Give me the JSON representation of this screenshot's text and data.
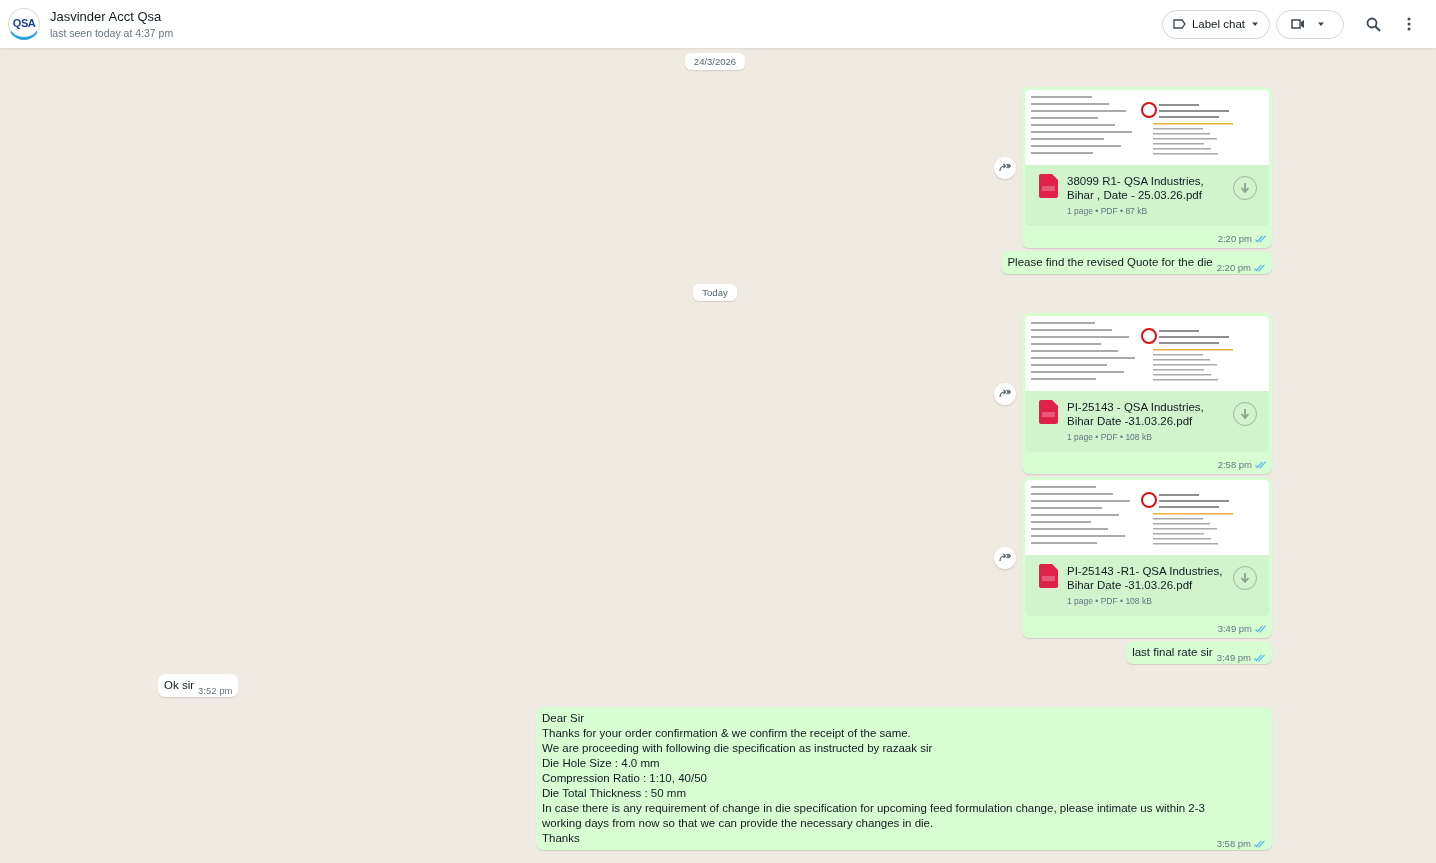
{
  "header": {
    "avatar_text": "QSA",
    "name": "Jasvinder Acct Qsa",
    "status": "last seen today at 4:37 pm",
    "label_button": "Label chat"
  },
  "messages": [
    {
      "kind": "date",
      "text": "24/3/2026"
    },
    {
      "kind": "document",
      "outgoing": true,
      "file_name": "38099 R1- QSA Industries, Bihar , Date - 25.03.26.pdf",
      "meta": "1 page • PDF • 87 kB",
      "time": "2:20 pm",
      "read": true
    },
    {
      "kind": "text",
      "outgoing": true,
      "text": "Please find the revised Quote for the die",
      "time": "2:20 pm",
      "read": true
    },
    {
      "kind": "date",
      "text": "Today"
    },
    {
      "kind": "document",
      "outgoing": true,
      "file_name": "PI-25143 - QSA Industries, Bihar Date -31.03.26.pdf",
      "meta": "1 page • PDF • 108 kB",
      "time": "2:58 pm",
      "read": true
    },
    {
      "kind": "document",
      "outgoing": true,
      "file_name": "PI-25143 -R1- QSA Industries, Bihar Date -31.03.26.pdf",
      "meta": "1 page • PDF • 108 kB",
      "time": "3:49 pm",
      "read": true
    },
    {
      "kind": "text",
      "outgoing": true,
      "text": "last final rate sir",
      "time": "3:49 pm",
      "read": true
    },
    {
      "kind": "text",
      "outgoing": false,
      "text": "Ok sir",
      "time": "3:52 pm"
    },
    {
      "kind": "text",
      "outgoing": true,
      "text": "Dear Sir\nThanks for your order confirmation & we confirm the receipt of the same.\nWe are proceeding with following die specification as instructed by razaak sir\nDie Hole Size : 4.0 mm\nCompression Ratio : 1:10, 40/50\nDie Total Thickness : 50 mm\nIn case there is any requirement of change in die specification for upcoming feed formulation change, please intimate us within 2-3 working days from now so that we can provide the necessary changes in die.\nThanks",
      "time": "3:58 pm",
      "read": true
    }
  ]
}
